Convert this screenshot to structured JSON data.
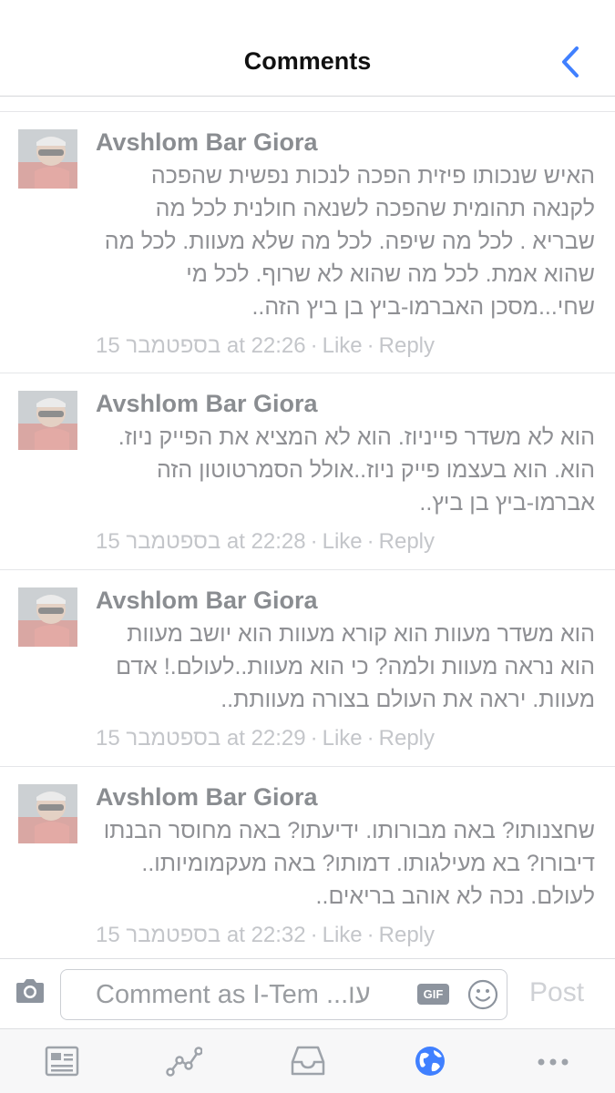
{
  "header": {
    "title": "Comments",
    "back_icon": "chevron-left-icon",
    "accent": "#4080ff"
  },
  "comments": [
    {
      "author": "Avshlom Bar Giora",
      "text": "האיש שנכותו פיזית הפכה לנכות נפשית שהפכה לקנאה תהומית שהפכה לשנאה חולנית לכל מה שבריא . לכל מה שיפה. לכל מה שלא מעוות. לכל מה שהוא אמת. לכל מה שהוא לא שרוף. לכל מי שחי...מסכן האברמו-ביץ בן ביץ הזה..",
      "date": "בספטמבר 15",
      "time_sep": "at",
      "time": "22:26",
      "like": "Like",
      "reply": "Reply"
    },
    {
      "author": "Avshlom Bar Giora",
      "text": "הוא לא משדר פייניוז. הוא לא המציא את הפייק ניוז. הוא. הוא בעצמו פייק ניוז..אולל הסמרטוטון הזה אברמו-ביץ בן ביץ..",
      "date": "בספטמבר 15",
      "time_sep": "at",
      "time": "22:28",
      "like": "Like",
      "reply": "Reply"
    },
    {
      "author": "Avshlom Bar Giora",
      "text": "הוא משדר מעוות הוא קורא מעוות הוא יושב מעוות הוא נראה מעוות ולמה? כי הוא מעוות..לעולם.! אדם מעוות. יראה את העולם בצורה מעוותת..",
      "date": "בספטמבר 15",
      "time_sep": "at",
      "time": "22:29",
      "like": "Like",
      "reply": "Reply"
    },
    {
      "author": "Avshlom Bar Giora",
      "text": "שחצנותו? באה מבורותו. ידיעתו? באה מחוסר הבנתו דיבורו? בא מעילגותו. דמותו? באה מעקמומיותו.. לעולם. נכה לא אוהב בריאים..",
      "date": "בספטמבר 15",
      "time_sep": "at",
      "time": "22:32",
      "like": "Like",
      "reply": "Reply"
    }
  ],
  "composer": {
    "camera_icon": "camera-icon",
    "placeholder": "Comment as I-Tem ...עו",
    "gif_label": "GIF",
    "emoji_icon": "smiley-icon",
    "post_label": "Post"
  },
  "tabbar": {
    "tabs": [
      {
        "name": "news-feed",
        "icon": "news-feed-icon",
        "active": false
      },
      {
        "name": "activity",
        "icon": "line-graph-icon",
        "active": false
      },
      {
        "name": "inbox",
        "icon": "inbox-tray-icon",
        "active": false
      },
      {
        "name": "notifications",
        "icon": "globe-icon",
        "active": true
      },
      {
        "name": "more",
        "icon": "more-dots-icon",
        "active": false
      }
    ],
    "active_color": "#4080ff",
    "inactive_color": "#9ea3aa"
  }
}
